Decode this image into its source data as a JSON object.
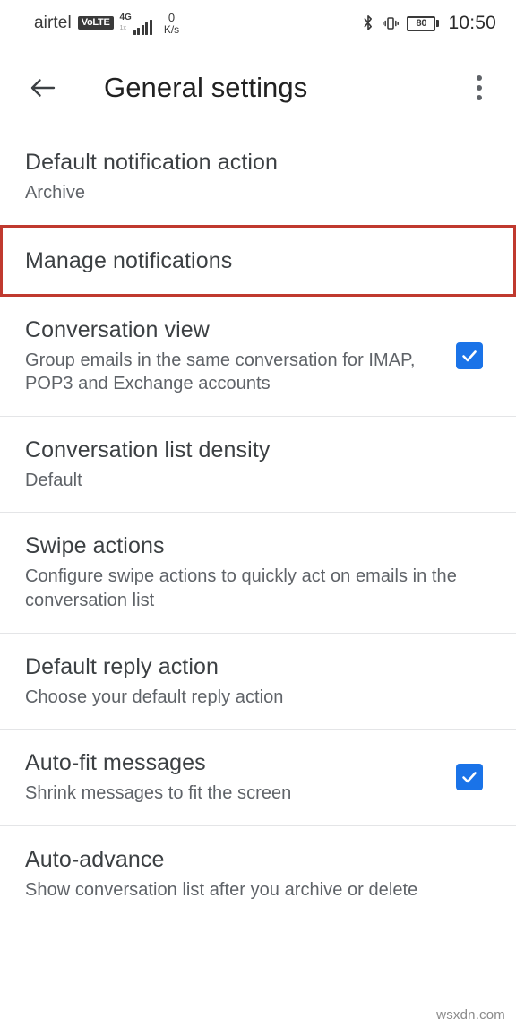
{
  "status_bar": {
    "carrier": "airtel",
    "volte_badge": "VoLTE",
    "network_type": "4G",
    "network_sub": "1x",
    "data_speed_value": "0",
    "data_speed_unit": "K/s",
    "bluetooth_icon": "bluetooth-icon",
    "vibrate_icon": "vibrate-icon",
    "battery_level": "80",
    "time": "10:50"
  },
  "app_bar": {
    "back_icon": "back-arrow-icon",
    "title": "General settings",
    "overflow_icon": "overflow-menu-icon"
  },
  "settings": [
    {
      "title": "Default notification action",
      "subtitle": "Archive",
      "has_checkbox": false,
      "checked": false,
      "highlighted": false,
      "divider_after": false
    },
    {
      "title": "Manage notifications",
      "subtitle": "",
      "has_checkbox": false,
      "checked": false,
      "highlighted": true,
      "divider_after": false
    },
    {
      "title": "Conversation view",
      "subtitle": "Group emails in the same conversation for IMAP, POP3 and Exchange accounts",
      "has_checkbox": true,
      "checked": true,
      "highlighted": false,
      "divider_after": true
    },
    {
      "title": "Conversation list density",
      "subtitle": "Default",
      "has_checkbox": false,
      "checked": false,
      "highlighted": false,
      "divider_after": true
    },
    {
      "title": "Swipe actions",
      "subtitle": "Configure swipe actions to quickly act on emails in the conversation list",
      "has_checkbox": false,
      "checked": false,
      "highlighted": false,
      "divider_after": true
    },
    {
      "title": "Default reply action",
      "subtitle": "Choose your default reply action",
      "has_checkbox": false,
      "checked": false,
      "highlighted": false,
      "divider_after": true
    },
    {
      "title": "Auto-fit messages",
      "subtitle": "Shrink messages to fit the screen",
      "has_checkbox": true,
      "checked": true,
      "highlighted": false,
      "divider_after": true
    },
    {
      "title": "Auto-advance",
      "subtitle": "Show conversation list after you archive or delete",
      "has_checkbox": false,
      "checked": false,
      "highlighted": false,
      "divider_after": false
    }
  ],
  "watermark": "wsxdn.com",
  "colors": {
    "highlight_border": "#c0392f",
    "checkbox_accent": "#1a73e8",
    "title_text": "#3c4043",
    "subtitle_text": "#5f6368",
    "divider": "#e4e5e7"
  }
}
